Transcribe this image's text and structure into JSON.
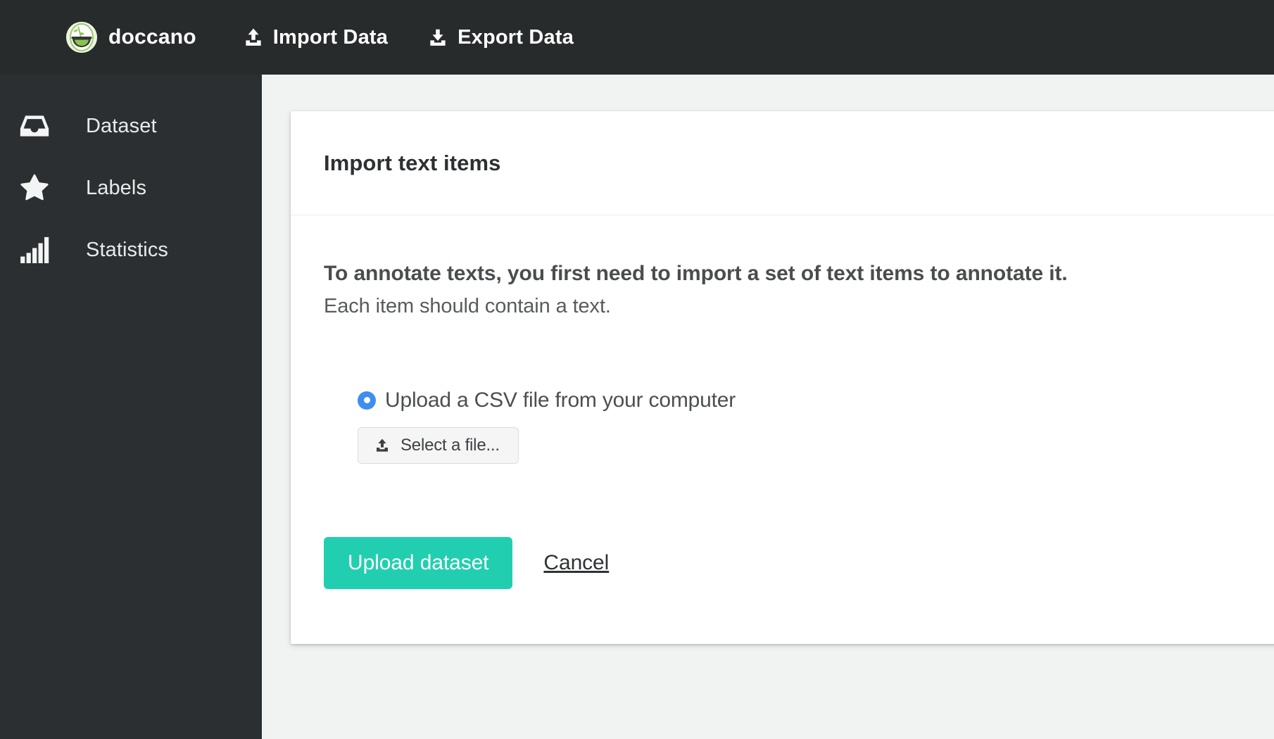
{
  "topbar": {
    "brand": {
      "name": "doccano",
      "logo_icon": "doccano-logo-icon"
    },
    "links": [
      {
        "label": "Import Data",
        "icon": "upload-icon"
      },
      {
        "label": "Export Data",
        "icon": "download-icon"
      }
    ]
  },
  "sidebar": {
    "items": [
      {
        "label": "Dataset",
        "icon": "inbox-icon"
      },
      {
        "label": "Labels",
        "icon": "star-icon"
      },
      {
        "label": "Statistics",
        "icon": "bar-chart-icon"
      }
    ]
  },
  "card": {
    "title": "Import text items",
    "lead": "To annotate texts, you first need to import a set of text items to annotate it.",
    "sub": "Each item should contain a text.",
    "option": {
      "label": "Upload a CSV file from your computer",
      "selected": true,
      "file_button_label": "Select a file...",
      "file_button_icon": "upload-icon"
    },
    "actions": {
      "primary_label": "Upload dataset",
      "cancel_label": "Cancel"
    }
  },
  "colors": {
    "topbar_bg": "#272b2c",
    "sidebar_bg": "#2b2f31",
    "page_bg": "#f1f2f2",
    "accent_teal": "#21cfb0",
    "radio_blue": "#3e8ef0"
  }
}
